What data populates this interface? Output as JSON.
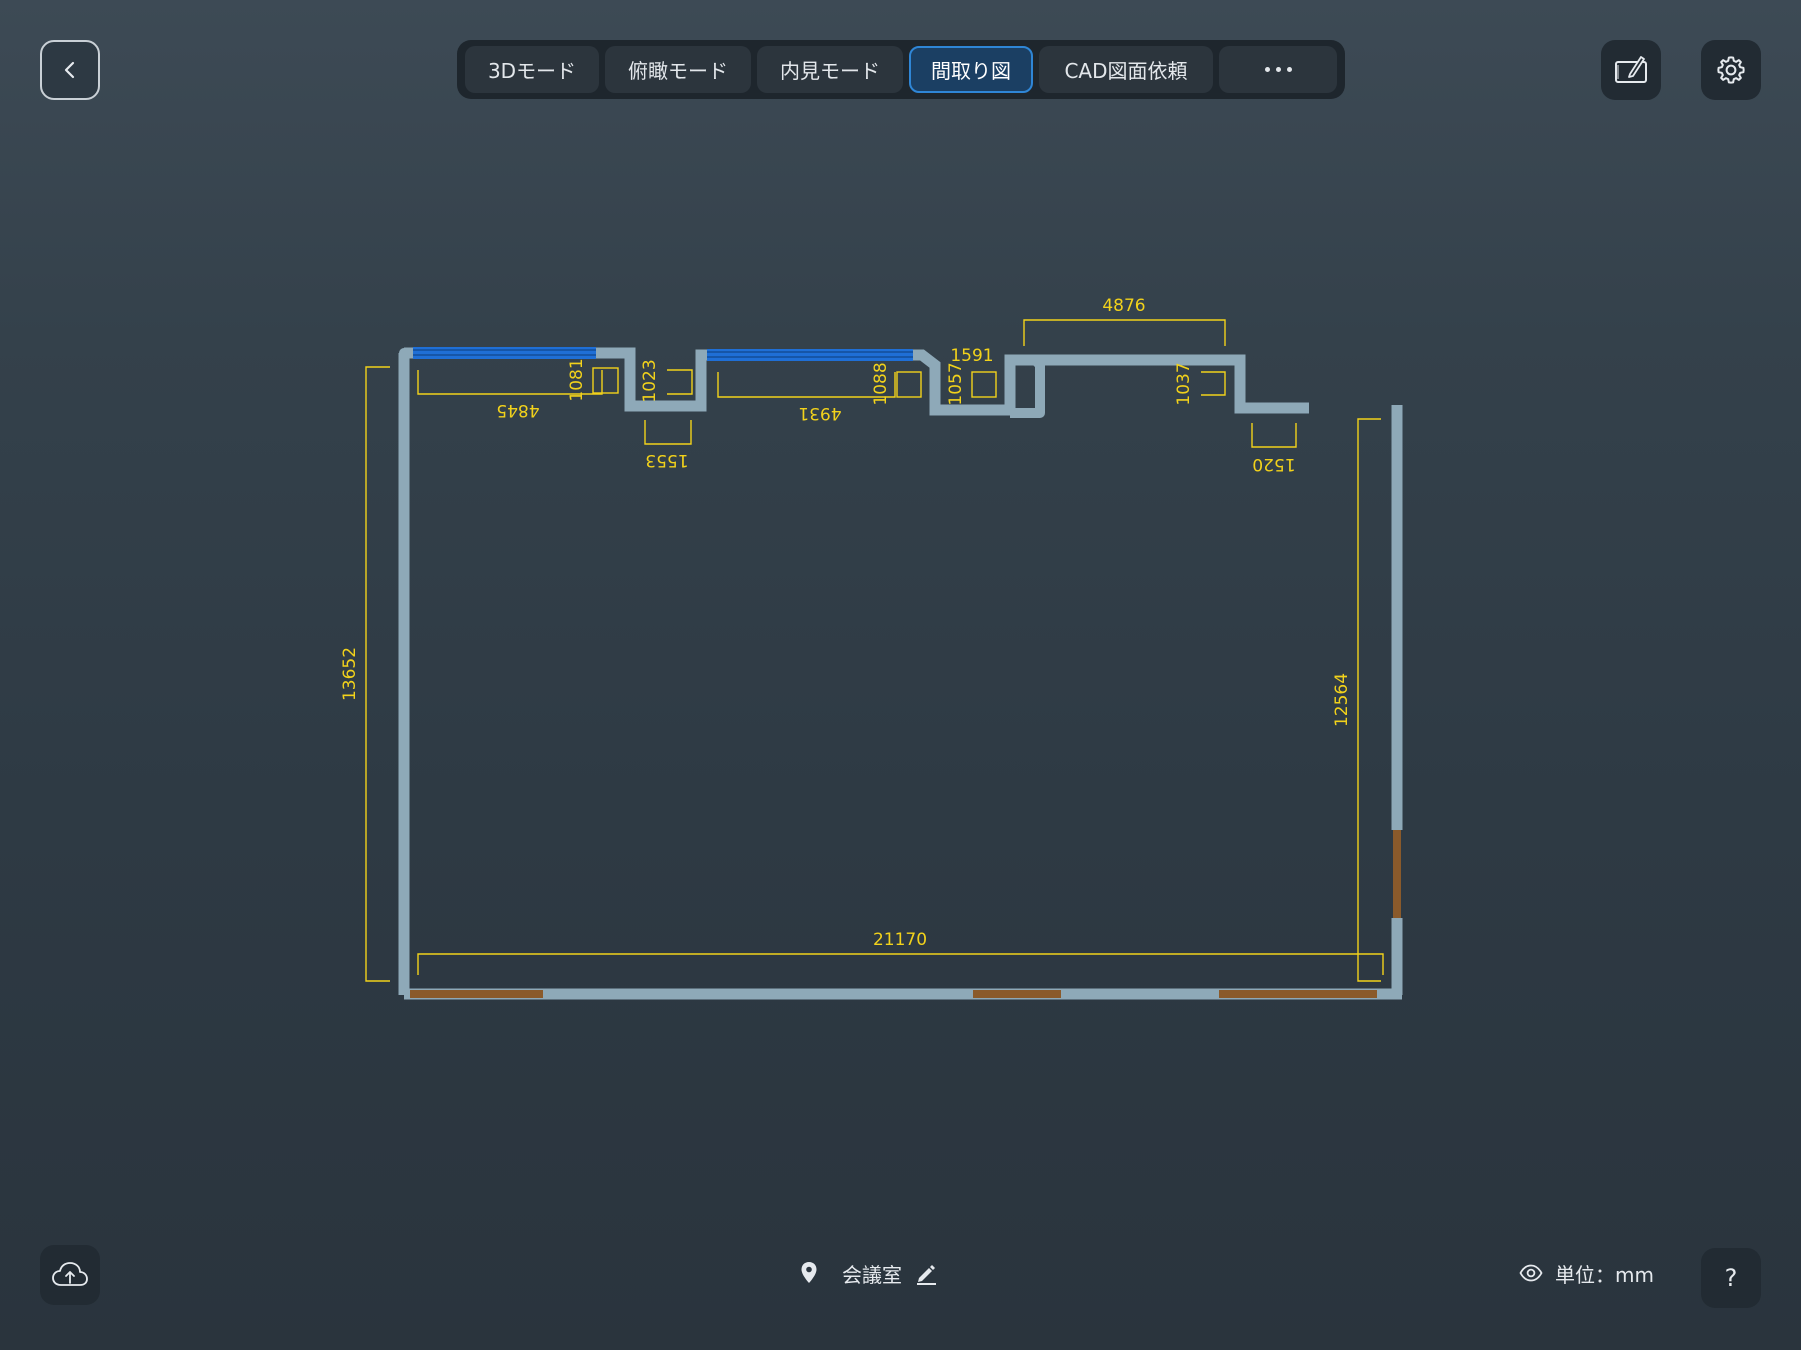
{
  "toolbar": {
    "tabs": [
      {
        "label": "3Dモード"
      },
      {
        "label": "俯瞰モード"
      },
      {
        "label": "内見モード"
      },
      {
        "label": "間取り図"
      },
      {
        "label": "CAD図面依頼"
      }
    ],
    "active_tab": "間取り図",
    "more_icon": "more-horizontal-icon"
  },
  "icons": {
    "back": "chevron-left-icon",
    "sketch": "tablet-pencil-icon",
    "settings": "gear-icon",
    "upload": "cloud-upload-icon",
    "location": "location-pin-icon",
    "edit": "pencil-icon",
    "visibility": "eye-icon",
    "help": "question-icon"
  },
  "floorplan": {
    "unit": "mm",
    "dimensions": {
      "top_width_1": "4845",
      "top_depth_1": "1081",
      "notch_depth_1": "1023",
      "notch_width_1": "1553",
      "top_width_2": "4931",
      "top_depth_2": "1088",
      "notch_width_2": "1591",
      "notch_depth_2": "1057",
      "top_width_3": "4876",
      "top_depth_3": "1037",
      "notch_width_3": "1520",
      "left_height": "13652",
      "right_height": "12564",
      "bottom_width": "21170"
    },
    "colors": {
      "wall": "#8ea9b8",
      "window": "#1f6fd6",
      "door": "#8a5a2b",
      "dimension": "#f2d21b"
    }
  },
  "footer": {
    "room_name": "会議室",
    "unit_label": "単位：mm",
    "help_label": "?"
  }
}
